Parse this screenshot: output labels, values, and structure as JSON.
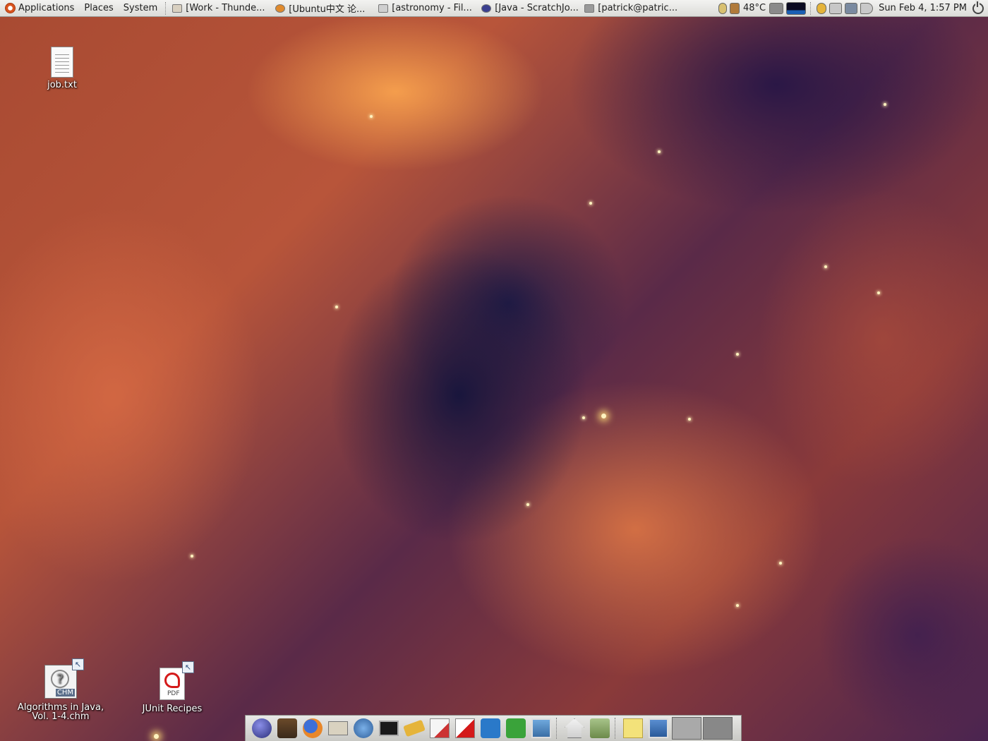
{
  "top_panel": {
    "menus": {
      "applications": "Applications",
      "places": "Places",
      "system": "System"
    },
    "tasks": [
      {
        "label": "[Work - Thunde...",
        "icon": "thunderbird-icon"
      },
      {
        "label": "[Ubuntu中文 论...",
        "icon": "firefox-icon"
      },
      {
        "label": "[astronomy - Fil...",
        "icon": "file-manager-icon"
      },
      {
        "label": "[Java - ScratchJo...",
        "icon": "eclipse-icon"
      },
      {
        "label": "[patrick@patric...",
        "icon": "terminal-icon"
      }
    ],
    "tray": {
      "temperature": "48°C",
      "clock": "Sun Feb  4,  1:57 PM"
    }
  },
  "desktop_icons": {
    "job_txt": "job.txt",
    "chm_line1": "Algorithms in Java,",
    "chm_line2": "Vol. 1-4.chm",
    "chm_tag": "CHM",
    "pdf_label": "JUnit Recipes",
    "pdf_tag": "PDF"
  },
  "dock": {
    "launchers": [
      "eclipse-icon",
      "gimp-icon",
      "firefox-icon",
      "mail-icon",
      "chat-icon",
      "terminal-icon",
      "notes-icon",
      "text-editor-icon",
      "pdf-viewer-icon",
      "writer-icon",
      "spreadsheet-icon",
      "image-viewer-icon",
      "home-icon",
      "trash-icon",
      "sticky-notes-icon",
      "show-desktop-icon"
    ]
  },
  "colors": {
    "panel_bg": "#e6e6e3",
    "ubuntu_orange": "#d9541e"
  }
}
